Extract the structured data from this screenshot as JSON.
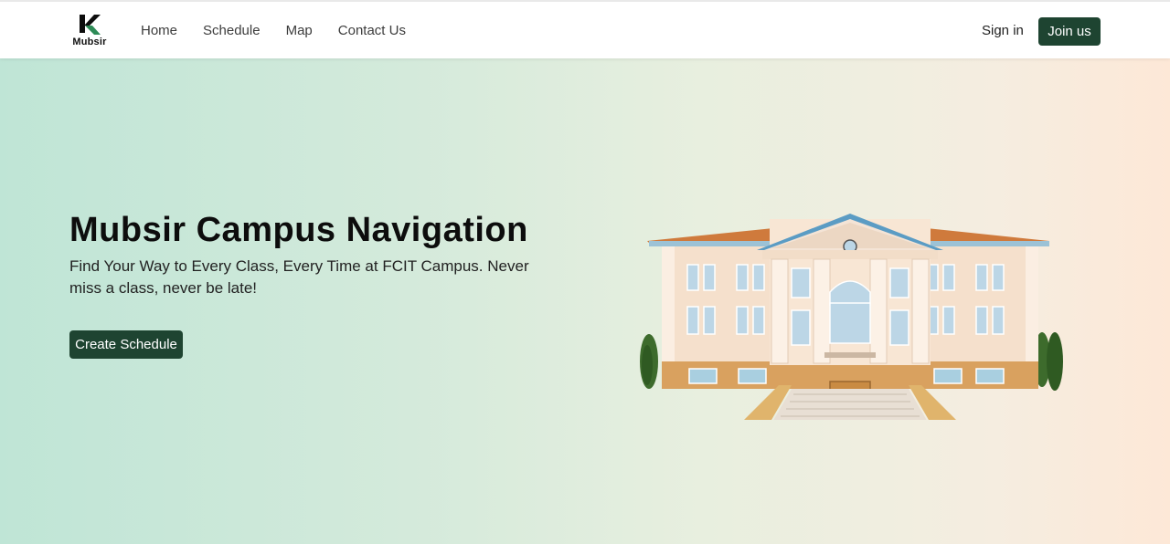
{
  "brand": {
    "name": "Mubsir",
    "logo_letter": "K",
    "accent": "#1e4431"
  },
  "nav": {
    "links": [
      "Home",
      "Schedule",
      "Map",
      "Contact Us"
    ],
    "signin": "Sign in",
    "join": "Join us"
  },
  "hero": {
    "title": "Mubsir Campus Navigation",
    "subtitle": "Find Your Way to Every Class, Every Time at FCIT Campus. Never miss a class, never be late!",
    "cta": "Create Schedule",
    "image": "campus-building-illustration"
  }
}
